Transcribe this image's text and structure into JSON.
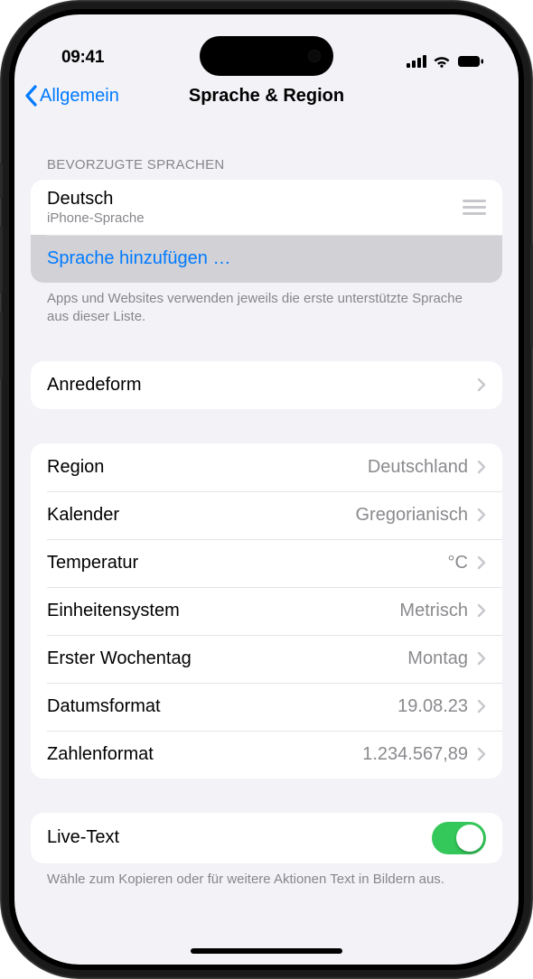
{
  "status_bar": {
    "time": "09:41"
  },
  "nav": {
    "back_label": "Allgemein",
    "title": "Sprache & Region"
  },
  "preferred": {
    "header": "BEVORZUGTE SPRACHEN",
    "language": "Deutsch",
    "language_sub": "iPhone-Sprache",
    "add_label": "Sprache hinzufügen …",
    "footer": "Apps und Websites verwenden jeweils die erste unterstützte Sprache aus dieser Liste."
  },
  "address_form": {
    "label": "Anredeform"
  },
  "regional": {
    "items": [
      {
        "label": "Region",
        "value": "Deutschland"
      },
      {
        "label": "Kalender",
        "value": "Gregorianisch"
      },
      {
        "label": "Temperatur",
        "value": "°C"
      },
      {
        "label": "Einheitensystem",
        "value": "Metrisch"
      },
      {
        "label": "Erster Wochentag",
        "value": "Montag"
      },
      {
        "label": "Datumsformat",
        "value": "19.08.23"
      },
      {
        "label": "Zahlenformat",
        "value": "1.234.567,89"
      }
    ]
  },
  "live_text": {
    "label": "Live-Text",
    "enabled": true,
    "footer": "Wähle zum Kopieren oder für weitere Aktionen Text in Bildern aus."
  }
}
